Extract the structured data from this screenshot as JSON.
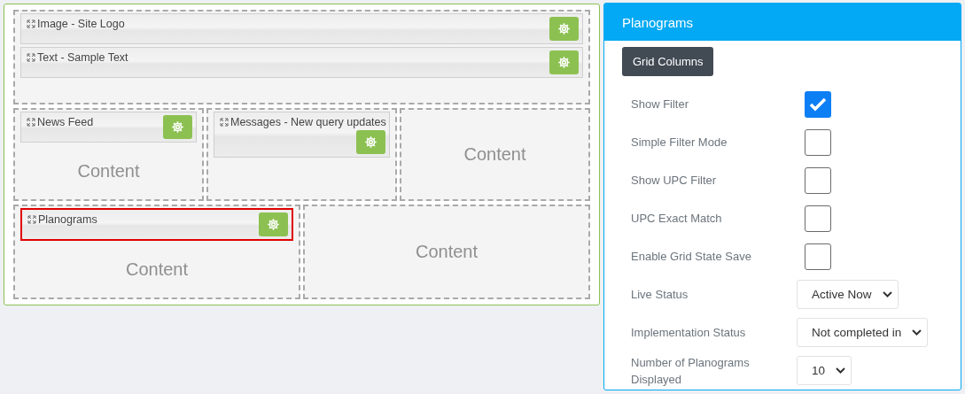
{
  "canvas": {
    "rows": [
      {
        "zones": [
          {
            "widgets": [
              {
                "title": "Image - Site Logo",
                "selected": false
              },
              {
                "title": "Text - Sample Text",
                "selected": false
              }
            ]
          }
        ]
      },
      {
        "zones": [
          {
            "widgets": [
              {
                "title": "News Feed",
                "selected": false
              }
            ],
            "content": "Content"
          },
          {
            "widgets": [
              {
                "title": "Messages - New query updates",
                "selected": false
              }
            ]
          },
          {
            "content": "Content"
          }
        ]
      },
      {
        "zones": [
          {
            "widgets": [
              {
                "title": "Planograms",
                "selected": true
              }
            ],
            "content": "Content"
          },
          {
            "content": "Content"
          }
        ]
      }
    ]
  },
  "panel": {
    "title": "Planograms",
    "button": "Grid Columns",
    "settings": [
      {
        "kind": "checkbox",
        "label": "Show Filter",
        "checked": true
      },
      {
        "kind": "checkbox",
        "label": "Simple Filter Mode",
        "checked": false
      },
      {
        "kind": "checkbox",
        "label": "Show UPC Filter",
        "checked": false
      },
      {
        "kind": "checkbox",
        "label": "UPC Exact Match",
        "checked": false
      },
      {
        "kind": "checkbox",
        "label": "Enable Grid State Save",
        "checked": false
      },
      {
        "kind": "select",
        "label": "Live Status",
        "value": "Active Now"
      },
      {
        "kind": "select",
        "label": "Implementation Status",
        "value": "Not completed in"
      },
      {
        "kind": "select",
        "label": "Number of Planograms Displayed",
        "value": "10"
      }
    ]
  }
}
